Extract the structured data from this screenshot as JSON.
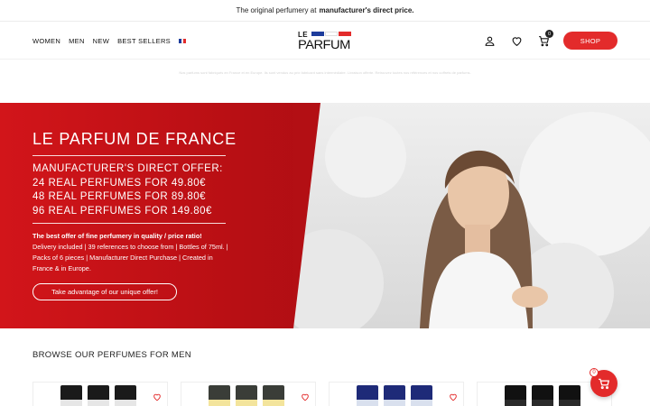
{
  "topbar": {
    "text": "The original perfumery at",
    "bold": "manufacturer's direct price."
  },
  "nav": {
    "links": [
      "WOMEN",
      "MEN",
      "NEW",
      "BEST SELLERS"
    ]
  },
  "logo": {
    "le": "LE",
    "parfum": "PARFUM"
  },
  "header": {
    "shop_label": "SHOP",
    "cart_count": "0"
  },
  "notice": "Nos parfums sont fabriqués en France et en Europe. Ils sont vendus au prix fabricant sans intermédiaire. Livraison offerte. Retrouvez toutes nos références et nos coffrets de parfums.",
  "hero": {
    "title": "LE PARFUM DE FRANCE",
    "offer_lines": [
      "MANUFACTURER'S DIRECT OFFER:",
      "24 REAL PERFUMES FOR 49.80€",
      "48 REAL PERFUMES FOR 89.80€",
      "96 REAL PERFUMES FOR 149.80€"
    ],
    "desc_bold": "The best offer of fine perfumery in quality / price ratio!",
    "desc": "Delivery included | 39 references to choose from | Bottles of 75ml. | Packs of 6 pieces | Manufacturer Direct Purchase | Created in France & in Europe.",
    "cta": "Take advantage of our unique offer!"
  },
  "section": {
    "title": "BROWSE OUR PERFUMES FOR MEN"
  },
  "float_cart": {
    "count": "0"
  },
  "colors": {
    "accent": "#e32b2b",
    "hero_red": "#c3141a"
  }
}
